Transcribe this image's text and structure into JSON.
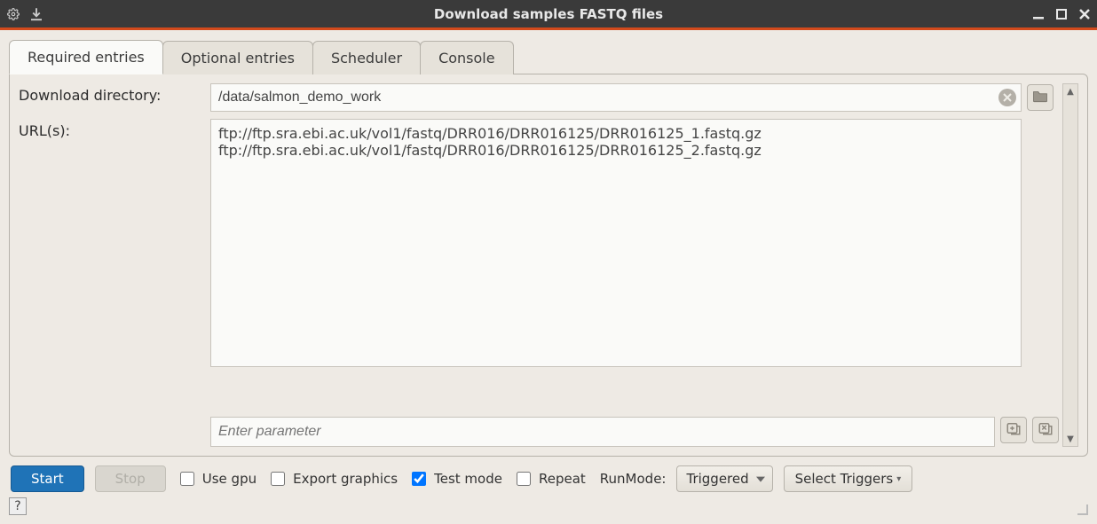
{
  "window": {
    "title": "Download samples FASTQ files"
  },
  "tabs": [
    {
      "label": "Required entries",
      "active": true
    },
    {
      "label": "Optional entries",
      "active": false
    },
    {
      "label": "Scheduler",
      "active": false
    },
    {
      "label": "Console",
      "active": false
    }
  ],
  "form": {
    "dir_label": "Download directory:",
    "dir_value": "/data/salmon_demo_work",
    "urls_label": "URL(s):",
    "urls_value": "ftp://ftp.sra.ebi.ac.uk/vol1/fastq/DRR016/DRR016125/DRR016125_1.fastq.gz\nftp://ftp.sra.ebi.ac.uk/vol1/fastq/DRR016/DRR016125/DRR016125_2.fastq.gz",
    "param_placeholder": "Enter parameter"
  },
  "controls": {
    "start": "Start",
    "stop": "Stop",
    "use_gpu": "Use gpu",
    "export_graphics": "Export graphics",
    "test_mode": "Test mode",
    "repeat": "Repeat",
    "runmode_label": "RunMode:",
    "runmode_value": "Triggered",
    "select_triggers": "Select Triggers"
  },
  "checkbox_state": {
    "use_gpu": false,
    "export_graphics": false,
    "test_mode": true,
    "repeat": false
  },
  "help": "?"
}
